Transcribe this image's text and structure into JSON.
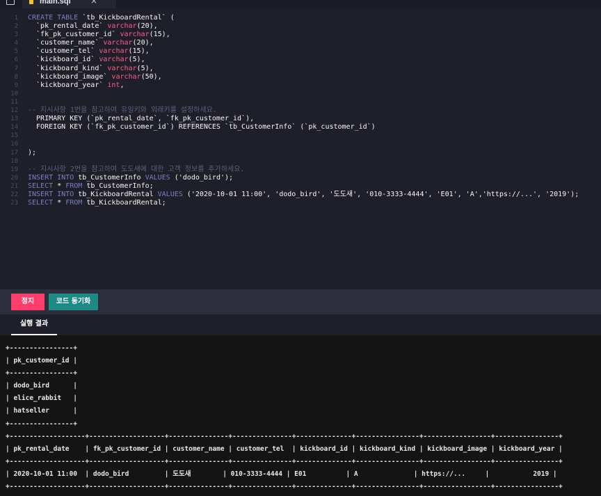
{
  "tab": {
    "filename": "main.sql"
  },
  "editor": {
    "line_numbers": [
      "1",
      "2",
      "3",
      "4",
      "5",
      "6",
      "7",
      "8",
      "9",
      "10",
      "11",
      "12",
      "13",
      "14",
      "15",
      "16",
      "17",
      "18",
      "19",
      "20",
      "21",
      "22",
      "23"
    ],
    "lines": [
      [
        {
          "t": "CREATE TABLE ",
          "c": "k"
        },
        {
          "t": "`tb_KickboardRental` ("
        }
      ],
      [
        {
          "t": "  `pk_rental_date` "
        },
        {
          "t": "varchar",
          "c": "n"
        },
        {
          "t": "(20),"
        }
      ],
      [
        {
          "t": "  `fk_pk_customer_id` "
        },
        {
          "t": "varchar",
          "c": "n"
        },
        {
          "t": "(15),"
        }
      ],
      [
        {
          "t": "  `customer_name` "
        },
        {
          "t": "varchar",
          "c": "n"
        },
        {
          "t": "(20),"
        }
      ],
      [
        {
          "t": "  `customer_tel` "
        },
        {
          "t": "varchar",
          "c": "n"
        },
        {
          "t": "(15),"
        }
      ],
      [
        {
          "t": "  `kickboard_id` "
        },
        {
          "t": "varchar",
          "c": "n"
        },
        {
          "t": "(5),"
        }
      ],
      [
        {
          "t": "  `kickboard_kind` "
        },
        {
          "t": "varchar",
          "c": "n"
        },
        {
          "t": "(5),"
        }
      ],
      [
        {
          "t": "  `kickboard_image` "
        },
        {
          "t": "varchar",
          "c": "n"
        },
        {
          "t": "(50),"
        }
      ],
      [
        {
          "t": "  `kickboard_year` "
        },
        {
          "t": "int",
          "c": "n"
        },
        {
          "t": ","
        }
      ],
      [
        {
          "t": "  ",
          "c": "m"
        }
      ],
      [
        {
          "t": "  ",
          "c": "m"
        }
      ],
      [
        {
          "t": "-- 지시사항 1번을 참고하여 유일키와 외래키를 설정하세요.",
          "c": "m"
        }
      ],
      [
        {
          "t": "  PRIMARY KEY (`pk_rental_date`, `fk_pk_customer_id`),"
        }
      ],
      [
        {
          "t": "  FOREIGN KEY (`fk_pk_customer_id`) REFERENCES `tb_CustomerInfo` (`pk_customer_id`)"
        }
      ],
      [
        {
          "t": "  ",
          "c": "m"
        }
      ],
      [
        {
          "t": "  ",
          "c": "m"
        }
      ],
      [
        {
          "t": ");"
        }
      ],
      [
        {
          "t": ""
        }
      ],
      [
        {
          "t": "-- 지시사항 2번을 참고하여 도도새에 대한 고객 정보를 추가하세요.",
          "c": "m"
        }
      ],
      [
        {
          "t": "INSERT INTO ",
          "c": "k"
        },
        {
          "t": "tb_CustomerInfo "
        },
        {
          "t": "VALUES ",
          "c": "k"
        },
        {
          "t": "('dodo_bird');"
        }
      ],
      [
        {
          "t": "SELECT ",
          "c": "k"
        },
        {
          "t": "* "
        },
        {
          "t": "FROM ",
          "c": "k"
        },
        {
          "t": "tb_CustomerInfo;"
        }
      ],
      [
        {
          "t": "INSERT INTO ",
          "c": "k"
        },
        {
          "t": "tb_KickboardRental "
        },
        {
          "t": "VALUES ",
          "c": "k"
        },
        {
          "t": "('2020-10-01 11:00', 'dodo_bird', '도도새', '010-3333-4444', 'E01', 'A','https://...', '2019');"
        }
      ],
      [
        {
          "t": "SELECT ",
          "c": "k"
        },
        {
          "t": "* "
        },
        {
          "t": "FROM ",
          "c": "k"
        },
        {
          "t": "tb_KickboardRental;"
        }
      ]
    ]
  },
  "toolbar": {
    "stop_label": "정지",
    "sync_label": "코드 동기화"
  },
  "results": {
    "tab_label": "실행 결과",
    "output": "+----------------+\n| pk_customer_id |\n+----------------+\n| dodo_bird      |\n| elice_rabbit   |\n| hatseller      |\n+----------------+\n+-------------------+-------------------+---------------+---------------+--------------+----------------+-----------------+----------------+\n| pk_rental_date    | fk_pk_customer_id | customer_name | customer_tel  | kickboard_id | kickboard_kind | kickboard_image | kickboard_year |\n+-------------------+-------------------+---------------+---------------+--------------+----------------+-----------------+----------------+\n| 2020-10-01 11:00  | dodo_bird         | 도도새        | 010-3333-4444 | E01          | A              | https://...     |           2019 |\n+-------------------+-------------------+---------------+---------------+--------------+----------------+-----------------+----------------+"
  }
}
